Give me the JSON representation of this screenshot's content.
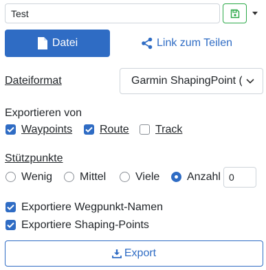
{
  "filename": {
    "value": "Test"
  },
  "buttons": {
    "file_label": "Datei",
    "share_label": "Link zum Teilen",
    "export_label": "Export"
  },
  "format": {
    "label": "Dateiformat",
    "selected": "Garmin ShapingPoint ("
  },
  "export_from": {
    "label": "Exportieren von",
    "options": [
      {
        "label": "Waypoints",
        "checked": true
      },
      {
        "label": "Route",
        "checked": true
      },
      {
        "label": "Track",
        "checked": false
      }
    ]
  },
  "support_points": {
    "label": "Stützpunkte",
    "options": [
      {
        "label": "Wenig",
        "selected": false
      },
      {
        "label": "Mittel",
        "selected": false
      },
      {
        "label": "Viele",
        "selected": false
      },
      {
        "label": "Anzahl",
        "selected": true
      }
    ],
    "count": "0"
  },
  "export_options": [
    {
      "label": "Exportiere Wegpunkt-Namen",
      "checked": true
    },
    {
      "label": "Exportiere Shaping-Points",
      "checked": true
    }
  ],
  "colors": {
    "primary": "#2f6cc4",
    "success": "#28a745"
  },
  "icons": [
    "save-icon",
    "caret-down-icon",
    "file-icon",
    "share-icon",
    "checkmark-icon",
    "download-icon"
  ]
}
